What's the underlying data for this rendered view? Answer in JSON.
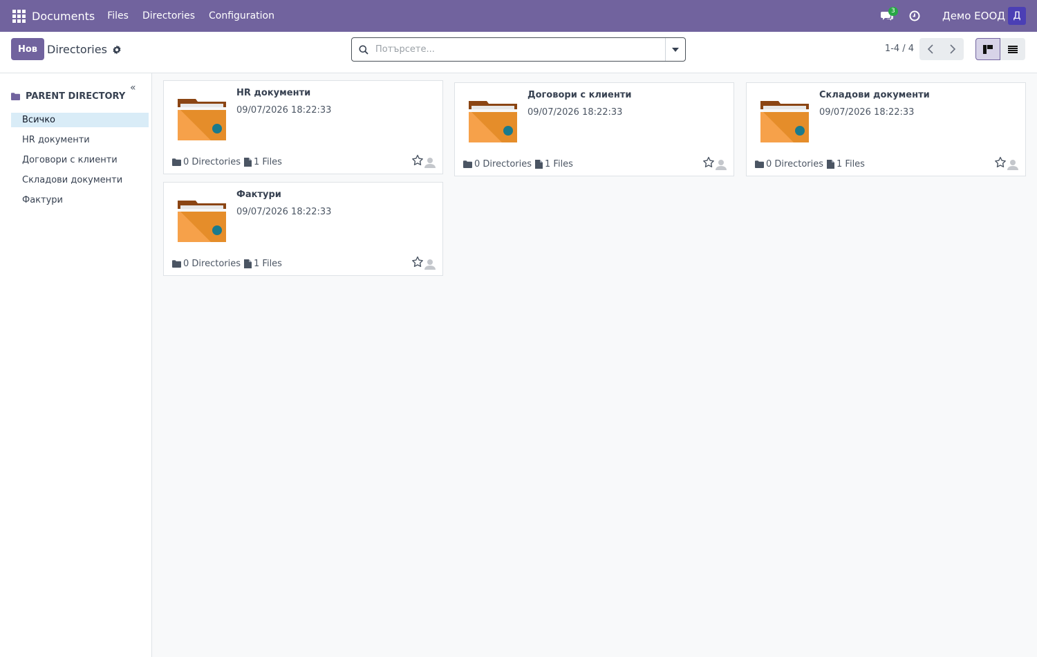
{
  "navbar": {
    "app_title": "Documents",
    "menu": [
      "Files",
      "Directories",
      "Configuration"
    ],
    "chat_count": "3",
    "company": "Демо ЕООД",
    "avatar_letter": "Д",
    "bg_color": "#71639e"
  },
  "control": {
    "new_label": "Нов",
    "breadcrumb": "Directories",
    "search_placeholder": "Потърсете...",
    "pager": "1-4 / 4"
  },
  "sidebar": {
    "header": "PARENT DIRECTORY",
    "collapse": "«",
    "items": [
      "Всичко",
      "HR документи",
      "Договори с клиенти",
      "Складови документи",
      "Фактури"
    ],
    "active_index": 0
  },
  "cards": [
    {
      "name": "HR документи",
      "date": "09/07/2026 18:22:33",
      "directories": "0 Directories",
      "files": "1 Files"
    },
    {
      "name": "Договори с клиенти",
      "date": "09/07/2026 18:22:33",
      "directories": "0 Directories",
      "files": "1 Files"
    },
    {
      "name": "Складови документи",
      "date": "09/07/2026 18:22:33",
      "directories": "0 Directories",
      "files": "1 Files"
    },
    {
      "name": "Фактури",
      "date": "09/07/2026 18:22:33",
      "directories": "0 Directories",
      "files": "1 Files"
    }
  ],
  "icons": {
    "apps": "apps-grid-icon",
    "chat": "chat-icon",
    "clock": "clock-icon",
    "settings": "gear-icon",
    "search": "search-icon",
    "folder": "folder-icon",
    "file": "file-icon",
    "star": "star-icon",
    "user": "user-icon"
  }
}
